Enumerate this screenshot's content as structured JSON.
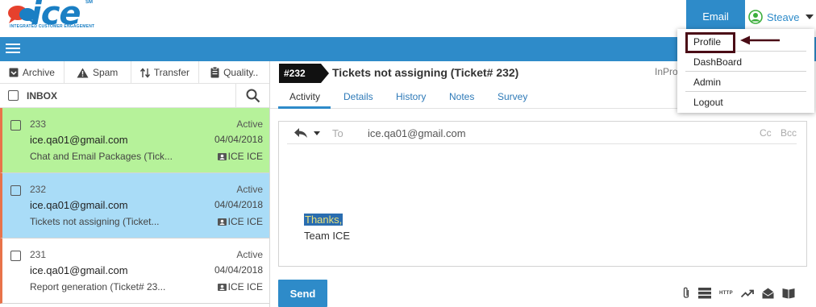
{
  "header": {
    "logo": {
      "word": "ice",
      "sm_mark": "SM",
      "tagline": "INTEGRATED CUSTOMER ENGAGEMENT"
    },
    "active_channel": "Email",
    "user_name": "Steave"
  },
  "toolbar": {
    "archive_label": "Archive",
    "spam_label": "Spam",
    "transfer_label": "Transfer",
    "quality_label": "Quality.."
  },
  "inbox": {
    "label": "INBOX",
    "tickets": [
      {
        "number": "233",
        "status": "Active",
        "email": "ice.qa01@gmail.com",
        "date": "04/04/2018",
        "subject": "Chat and Email Packages (Tick...",
        "agent": "ICE ICE",
        "bg": "#b6f29a",
        "accent": "#e8734a"
      },
      {
        "number": "232",
        "status": "Active",
        "email": "ice.qa01@gmail.com",
        "date": "04/04/2018",
        "subject": "Tickets not assigning (Ticket...",
        "agent": "ICE ICE",
        "bg": "#a9dcf7",
        "accent": "#e8734a"
      },
      {
        "number": "231",
        "status": "Active",
        "email": "ice.qa01@gmail.com",
        "date": "04/04/2018",
        "subject": "Report generation (Ticket# 23...",
        "agent": "ICE ICE",
        "bg": "#ffffff",
        "accent": "#e8734a"
      }
    ]
  },
  "ticket": {
    "badge": "#232",
    "title": "Tickets not assigning (Ticket# 232)",
    "state": "InPro"
  },
  "tabs": [
    "Activity",
    "Details",
    "History",
    "Notes",
    "Survey"
  ],
  "compose": {
    "to_label": "To",
    "to_value": "ice.qa01@gmail.com",
    "cc_label": "Cc",
    "bcc_label": "Bcc",
    "body_line1": "Thanks,",
    "body_line2": "Team ICE",
    "send_label": "Send",
    "http_label": "HTTP"
  },
  "user_dropdown": {
    "items": [
      "Profile",
      "DashBoard",
      "Admin",
      "Logout"
    ]
  },
  "colors": {
    "brand_blue": "#2e8bc9",
    "annotation": "#4a0c16"
  }
}
